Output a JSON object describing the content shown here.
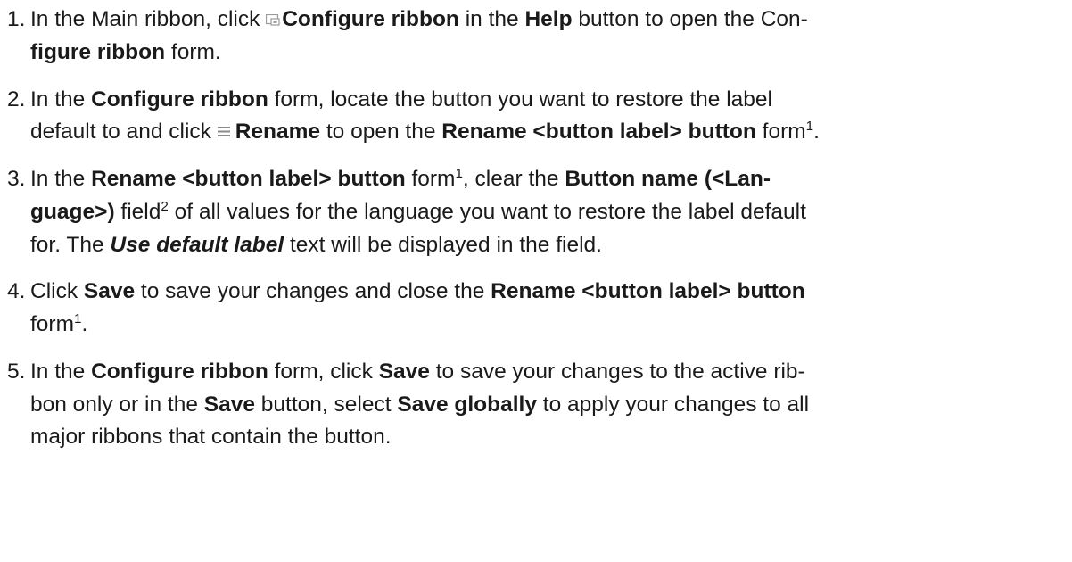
{
  "steps": [
    {
      "number": "1.",
      "segments": [
        {
          "t": "In the Main ribbon, click "
        },
        {
          "icon": "configure-ribbon-icon"
        },
        {
          "t": "Configure ribbon",
          "b": true
        },
        {
          "t": " in the "
        },
        {
          "t": "Help",
          "b": true
        },
        {
          "t": " button to open the "
        },
        {
          "t": "Con-"
        },
        {
          "br": true
        },
        {
          "t": "figure ribbon",
          "b": true
        },
        {
          "t": " form."
        }
      ]
    },
    {
      "number": "2.",
      "segments": [
        {
          "t": "In the "
        },
        {
          "t": "Configure ribbon",
          "b": true
        },
        {
          "t": " form, locate the button you want to restore the label"
        },
        {
          "br": true
        },
        {
          "t": "default to and click "
        },
        {
          "icon": "rename-icon"
        },
        {
          "t": "Rename",
          "b": true
        },
        {
          "t": " to open the "
        },
        {
          "t": "Rename <button label> button",
          "b": true
        },
        {
          "t": " form"
        },
        {
          "t": "1",
          "sup": true
        },
        {
          "t": "."
        }
      ]
    },
    {
      "number": "3.",
      "segments": [
        {
          "t": "In the "
        },
        {
          "t": "Rename <button label> button",
          "b": true
        },
        {
          "t": " form"
        },
        {
          "t": "1",
          "sup": true
        },
        {
          "t": ", clear the "
        },
        {
          "t": "Button name (<Lan-",
          "b": true
        },
        {
          "br": true
        },
        {
          "t": "guage>)",
          "b": true
        },
        {
          "t": " field"
        },
        {
          "t": "2",
          "sup": true
        },
        {
          "t": " of all values for the language you want to restore the label default"
        },
        {
          "br": true
        },
        {
          "t": "for. The "
        },
        {
          "t": "Use default label",
          "b": true,
          "i": true
        },
        {
          "t": " text will be displayed in the field."
        }
      ]
    },
    {
      "number": "4.",
      "segments": [
        {
          "t": "Click "
        },
        {
          "t": "Save",
          "b": true
        },
        {
          "t": " to save your changes and close the "
        },
        {
          "t": "Rename <button label> button",
          "b": true
        },
        {
          "br": true
        },
        {
          "t": "form"
        },
        {
          "t": "1",
          "sup": true
        },
        {
          "t": "."
        }
      ]
    },
    {
      "number": "5.",
      "segments": [
        {
          "t": "In the "
        },
        {
          "t": "Configure ribbon",
          "b": true
        },
        {
          "t": " form, click "
        },
        {
          "t": "Save",
          "b": true
        },
        {
          "t": " to save your changes to the active rib-"
        },
        {
          "br": true
        },
        {
          "t": "bon only or in the "
        },
        {
          "t": "Save",
          "b": true
        },
        {
          "t": " button, select "
        },
        {
          "t": "Save globally",
          "b": true
        },
        {
          "t": " to apply your changes to all"
        },
        {
          "br": true
        },
        {
          "t": "major ribbons that contain the button."
        }
      ]
    }
  ]
}
